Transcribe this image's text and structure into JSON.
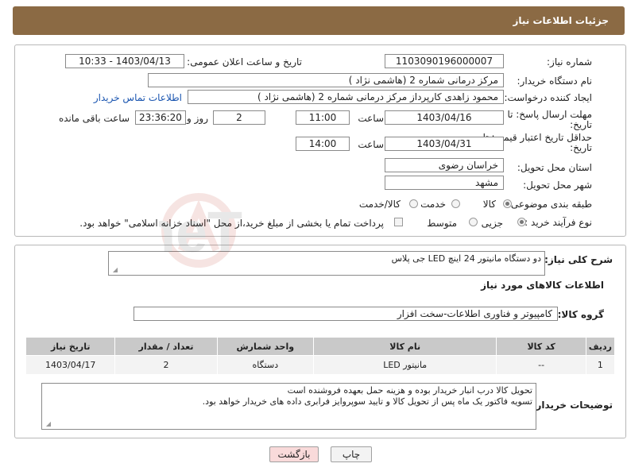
{
  "header": {
    "title": "جزئیات اطلاعات نیاز"
  },
  "form": {
    "need_number_label": "شماره نیاز:",
    "need_number": "1103090196000007",
    "announce_label": "تاریخ و ساعت اعلان عمومی:",
    "announce_value": "1403/04/13 - 10:33",
    "buyer_org_label": "نام دستگاه خریدار:",
    "buyer_org": "مرکز درمانی شماره 2 (هاشمی نژاد )",
    "requester_label": "ایجاد کننده درخواست:",
    "requester": "محمود زاهدی کارپرداز مرکز درمانی شماره 2 (هاشمی نژاد )",
    "contact_link": "اطلاعات تماس خریدار",
    "reply_deadline_label_1": "مهلت ارسال پاسخ: تا",
    "reply_deadline_label_2": "تاریخ:",
    "reply_date": "1403/04/16",
    "time_label": "ساعت",
    "reply_time": "11:00",
    "days_value": "2",
    "days_label": "روز و",
    "remaining_time": "23:36:20",
    "remaining_label": "ساعت باقی مانده",
    "price_validity_label_1": "حداقل تاریخ اعتبار قیمت: تا",
    "price_validity_label_2": "تاریخ:",
    "validity_date": "1403/04/31",
    "validity_time": "14:00",
    "province_label": "استان محل تحویل:",
    "province": "خراسان رضوی",
    "city_label": "شهر محل تحویل:",
    "city": "مشهد",
    "category_label": "طبقه بندی موضوعی:",
    "category_options": [
      "کالا",
      "خدمت",
      "کالا/خدمت"
    ],
    "process_label": "نوع فرآیند خرید :",
    "process_options": [
      "جزیی",
      "متوسط"
    ],
    "payment_note": "پرداخت تمام یا بخشی از مبلغ خرید،از محل \"اسناد خزانه اسلامی\" خواهد بود."
  },
  "details": {
    "description_label": "شرح کلی نیاز:",
    "description": "دو دستگاه مانیتور 24 اینچ LED جی پلاس",
    "goods_info_title": "اطلاعات کالاهای مورد نیاز",
    "goods_group_label": "گروه کالا:",
    "goods_group": "کامپیوتر و فناوری اطلاعات-سخت افزار",
    "table": {
      "headers": [
        "ردیف",
        "کد کالا",
        "نام کالا",
        "واحد شمارش",
        "تعداد / مقدار",
        "تاریخ نیاز"
      ],
      "rows": [
        [
          "1",
          "--",
          "مانیتور LED",
          "دستگاه",
          "2",
          "1403/04/17"
        ]
      ]
    },
    "buyer_notes_label": "توضیحات خریدار:",
    "buyer_notes_line1": "تحویل کالا درب انبار خریدار بوده و هزینه حمل بعهده فروشنده است",
    "buyer_notes_line2": "تسویه فاکتور یک ماه پس از تحویل کالا و تایید سوپروایز فرابری داده های خریدار خواهد بود."
  },
  "buttons": {
    "print": "چاپ",
    "back": "بازگشت"
  },
  "watermark": {
    "text": "AriaTender.neT"
  },
  "colors": {
    "header_bg": "#8b6a44",
    "link": "#1a55b0",
    "back_button_bg": "#f9dada"
  }
}
